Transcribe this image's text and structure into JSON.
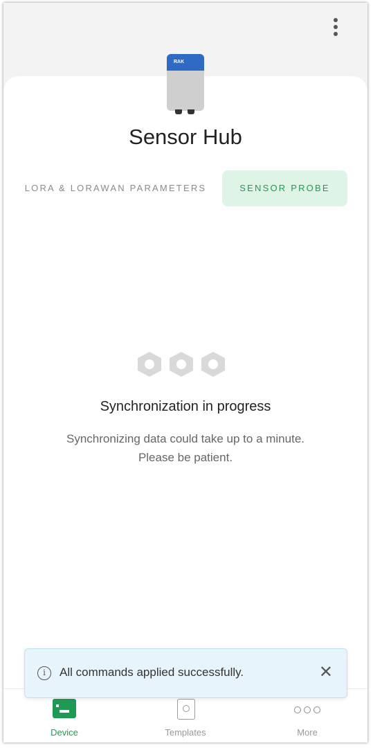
{
  "header": {
    "menu_icon": "more-vert-icon"
  },
  "device": {
    "brand_label": "RAK",
    "name": "Sensor Hub"
  },
  "tabs": [
    {
      "label": "LORA & LORAWAN PARAMETERS",
      "active": false
    },
    {
      "label": "SENSOR PROBE",
      "active": true
    }
  ],
  "sync": {
    "title": "Synchronization in progress",
    "message": "Synchronizing data could take up to a minute. Please be patient."
  },
  "toast": {
    "message": "All commands applied successfully.",
    "icon": "info-icon",
    "close_icon": "close-icon"
  },
  "bottom_nav": [
    {
      "label": "Device",
      "icon": "device-icon",
      "active": true
    },
    {
      "label": "Templates",
      "icon": "templates-icon",
      "active": false
    },
    {
      "label": "More",
      "icon": "more-horiz-icon",
      "active": false
    }
  ],
  "colors": {
    "accent": "#1f9a55",
    "active_tab_bg": "#ddf4e7",
    "toast_bg": "#e7f4fb"
  }
}
